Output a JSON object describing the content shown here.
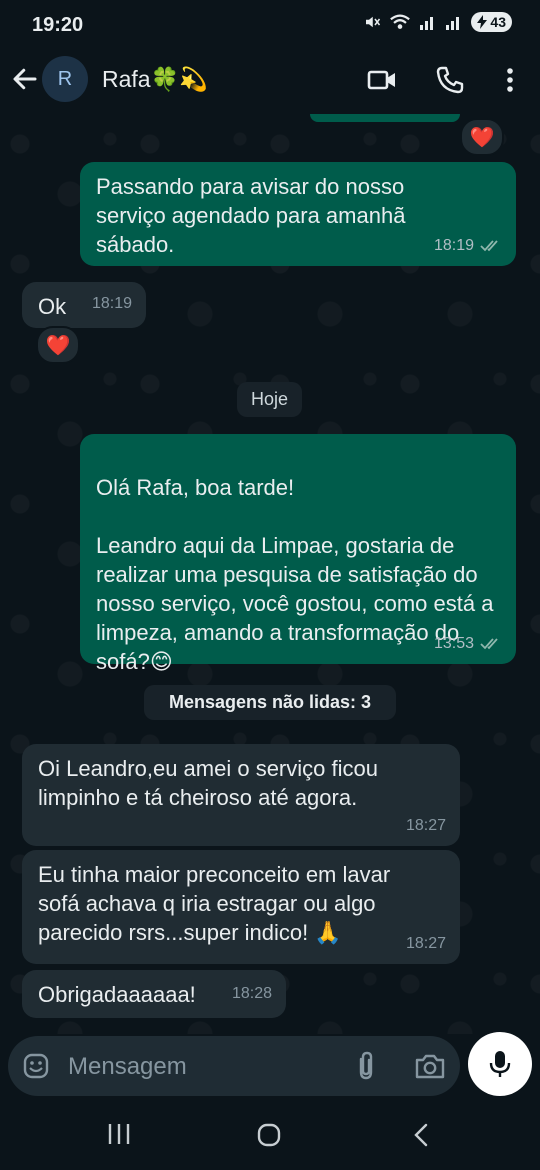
{
  "status": {
    "time": "19:20",
    "battery": "43"
  },
  "header": {
    "avatar_letter": "R",
    "contact_name": "Rafa🍀💫"
  },
  "messages": [
    {
      "dir": "out",
      "text": "Passando para avisar do nosso serviço agendado para amanhã sábado.",
      "time": "18:19"
    },
    {
      "dir": "in",
      "text": "Ok",
      "time": "18:19"
    },
    {
      "dir": "out",
      "text": "Olá Rafa, boa tarde!\n\nLeandro aqui da Limpae, gostaria de realizar uma pesquisa de satisfação do nosso serviço, você gostou, como está a limpeza, amando a transformação do sofá?😊",
      "time": "13:53"
    },
    {
      "dir": "in",
      "text": "Oi Leandro,eu amei  o serviço ficou limpinho e tá cheiroso até agora.",
      "time": "18:27"
    },
    {
      "dir": "in",
      "text": "Eu tinha maior preconceito em lavar sofá achava q iria estragar ou algo parecido rsrs...super indico! 🙏",
      "time": "18:27"
    },
    {
      "dir": "in",
      "text": "Obrigadaaaaaa!",
      "time": "18:28"
    }
  ],
  "reactions": {
    "top": "❤️",
    "ok": "❤️"
  },
  "date_divider": "Hoje",
  "unread_divider": "Mensagens não lidas: 3",
  "composer": {
    "placeholder": "Mensagem"
  }
}
